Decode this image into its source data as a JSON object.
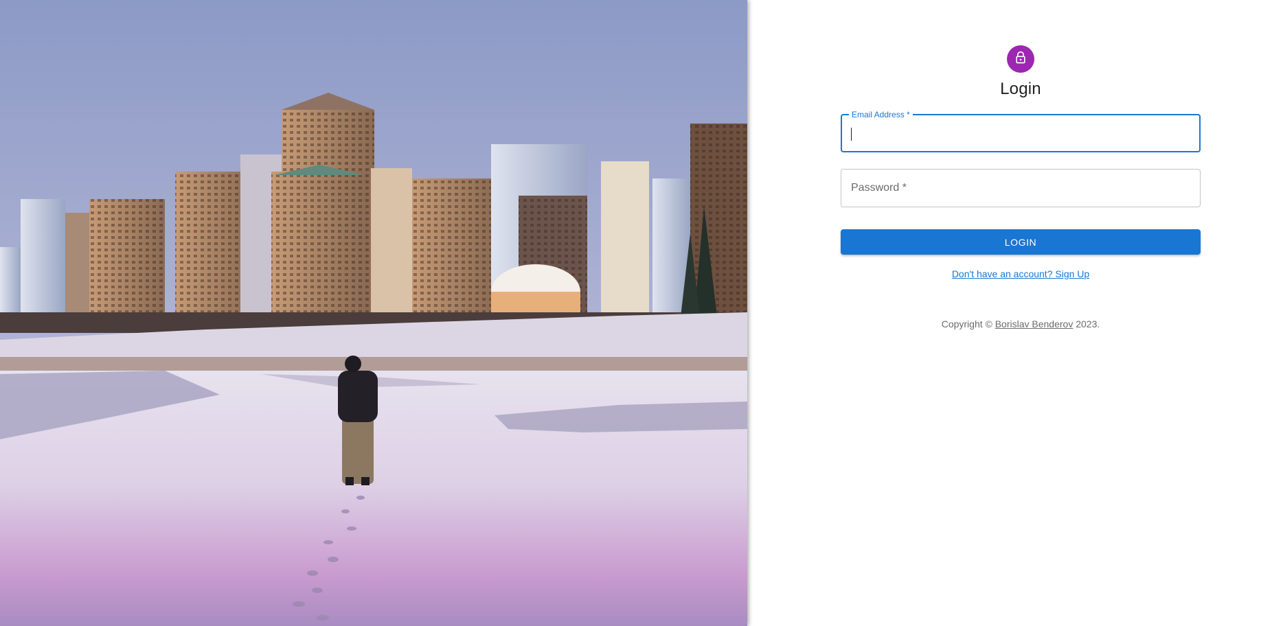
{
  "hero": {
    "image_description_icon": "city-skyline-winter-photo"
  },
  "login": {
    "icon": "lock-icon",
    "title": "Login",
    "email_label": "Email Address *",
    "email_value": "",
    "password_label": "Password *",
    "password_value": "",
    "button_label": "LOGIN",
    "signup_link": "Don't have an account? Sign Up"
  },
  "footer": {
    "prefix": "Copyright © ",
    "author": "Borislav Benderov",
    "suffix": " 2023."
  },
  "colors": {
    "accent": "#1976d2",
    "avatar": "#9c27b0"
  }
}
